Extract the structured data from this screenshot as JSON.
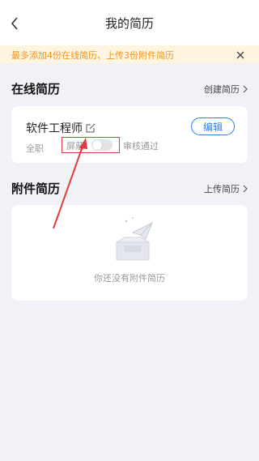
{
  "header": {
    "title": "我的简历",
    "back_icon": "chevron-left-icon"
  },
  "notice": {
    "text": "最多添加4份在线简历、上传3份附件简历",
    "close_icon": "close-icon",
    "color": "#f09624"
  },
  "online_section": {
    "title": "在线简历",
    "link": "创建简历"
  },
  "resume": {
    "name": "软件工程师",
    "edit_label": "编辑",
    "job_type": "全职",
    "mask_label": "屏蔽",
    "mask_enabled": false,
    "status": "审核通过"
  },
  "attachment_section": {
    "title": "附件简历",
    "link": "上传简历",
    "empty_text": "你还没有附件简历"
  },
  "colors": {
    "accent": "#2f7de1",
    "highlight": "#e23b3b"
  }
}
